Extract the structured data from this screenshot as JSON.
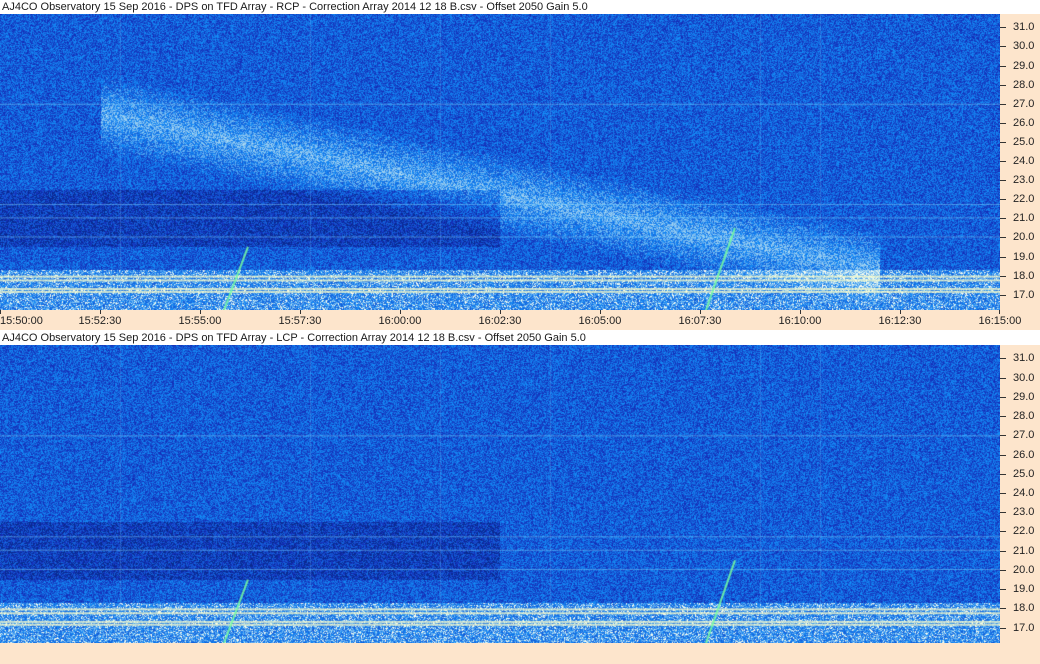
{
  "panels": [
    {
      "id": "rcp",
      "title": "AJ4CO Observatory 15 Sep 2016  -  DPS on TFD Array  -  RCP  -  Correction Array 2014 12 18 B.csv  -  Offset 2050  Gain 5.0",
      "x_labels": [
        "15:50:00",
        "15:52:30",
        "15:55:00",
        "15:57:30",
        "16:00:00",
        "16:02:30",
        "16:05:00",
        "16:07:30",
        "16:10:00",
        "16:12:30",
        "16:15:00"
      ]
    },
    {
      "id": "lcp",
      "title": "AJ4CO Observatory 15 Sep 2016  -  DPS on TFD Array  -  LCP  -  Correction Array 2014 12 18 B.csv  -  Offset 2050  Gain 5.0",
      "x_labels": []
    }
  ],
  "frequency_axis": {
    "unit_note": "",
    "labels": [
      "31.0",
      "30.0",
      "29.0",
      "28.0",
      "27.0",
      "26.0",
      "25.0",
      "24.0",
      "23.0",
      "22.0",
      "21.0",
      "20.0",
      "19.0",
      "18.0",
      "17.0"
    ],
    "min": 16.2,
    "max": 31.7
  },
  "colors": {
    "background_blue": "#1e48c8",
    "axis_background": "#fde5cc"
  }
}
